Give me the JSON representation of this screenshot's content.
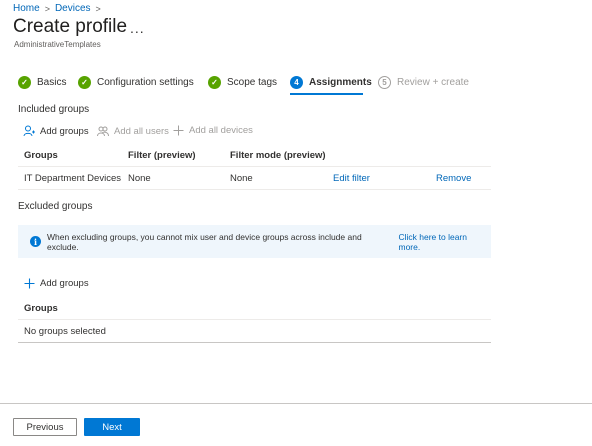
{
  "breadcrumb": {
    "items": [
      "Home",
      "Devices"
    ]
  },
  "header": {
    "title": "Create profile",
    "more": "...",
    "subtitle": "AdministrativeTemplates"
  },
  "steps": [
    {
      "label": "Basics",
      "state": "done"
    },
    {
      "label": "Configuration settings",
      "state": "done"
    },
    {
      "label": "Scope tags",
      "state": "done"
    },
    {
      "label": "Assignments",
      "state": "active",
      "number": "4"
    },
    {
      "label": "Review + create",
      "state": "pending",
      "number": "5"
    }
  ],
  "included": {
    "label": "Included groups",
    "actions": {
      "add_groups": "Add groups",
      "add_all_users": "Add all users",
      "add_all_devices": "Add all devices"
    },
    "columns": [
      "Groups",
      "Filter (preview)",
      "Filter mode (preview)"
    ],
    "rows": [
      {
        "group": "IT Department Devices",
        "filter": "None",
        "filter_mode": "None",
        "edit": "Edit filter",
        "remove": "Remove"
      }
    ]
  },
  "excluded": {
    "label": "Excluded groups",
    "info_text": "When excluding groups, you cannot mix user and device groups across include and exclude.",
    "info_link": "Click here to learn more.",
    "add_groups": "Add groups",
    "column": "Groups",
    "empty": "No groups selected"
  },
  "footer": {
    "previous": "Previous",
    "next": "Next"
  },
  "colors": {
    "accent": "#0078d4",
    "success": "#57a300",
    "link": "#0067b8"
  }
}
